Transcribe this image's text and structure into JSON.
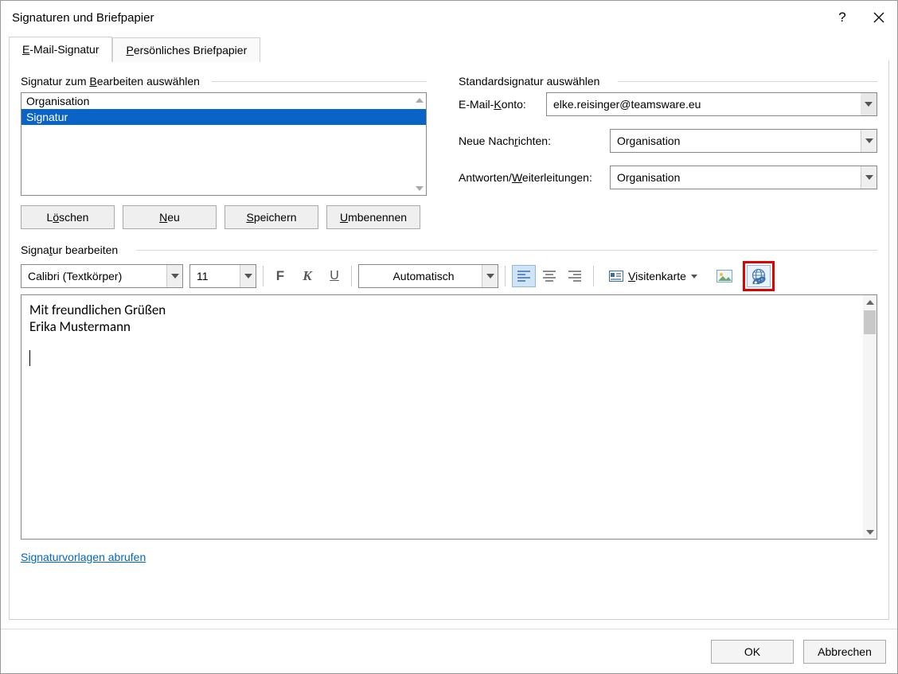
{
  "title": "Signaturen und Briefpapier",
  "tabs": {
    "signature_pre": "E",
    "signature_rest": "-Mail-Signatur",
    "stationery_pre": "P",
    "stationery_rest": "ersönliches Briefpapier"
  },
  "left": {
    "group_pre": "Signatur zum ",
    "group_acc": "B",
    "group_post": "earbeiten auswählen",
    "items": [
      {
        "label": "Organisation"
      },
      {
        "label": "Signatur"
      }
    ],
    "buttons": {
      "delete_pre": "L",
      "delete_acc": "ö",
      "delete_post": "schen",
      "new_pre": "",
      "new_acc": "N",
      "new_post": "eu",
      "save_pre": "",
      "save_acc": "S",
      "save_post": "peichern",
      "rename_pre": "",
      "rename_acc": "U",
      "rename_post": "mbenennen"
    }
  },
  "right": {
    "group": "Standardsignatur auswählen",
    "account_label_pre": "E-Mail-",
    "account_label_acc": "K",
    "account_label_post": "onto:",
    "account_value": "elke.reisinger@teamsware.eu",
    "new_label_pre": "Neue Nach",
    "new_label_acc": "r",
    "new_label_post": "ichten:",
    "new_value": "Organisation",
    "reply_label_pre": "Antworten/",
    "reply_label_acc": "W",
    "reply_label_post": "eiterleitungen:",
    "reply_value": "Organisation"
  },
  "edit": {
    "group_pre": "Signa",
    "group_acc": "t",
    "group_post": "ur bearbeiten",
    "font": "Calibri (Textkörper)",
    "size": "11",
    "bold": "F",
    "italic": "K",
    "underline": "U",
    "color": "Automatisch",
    "vcard_pre": "",
    "vcard_acc": "V",
    "vcard_post": "isitenkarte",
    "content_line1": "Mit freundlichen Grüßen",
    "content_line2": "Erika Mustermann"
  },
  "link_pre": "Si",
  "link_acc": "g",
  "link_post": "naturvorlagen abrufen",
  "footer": {
    "ok": "OK",
    "cancel": "Abbrechen"
  }
}
